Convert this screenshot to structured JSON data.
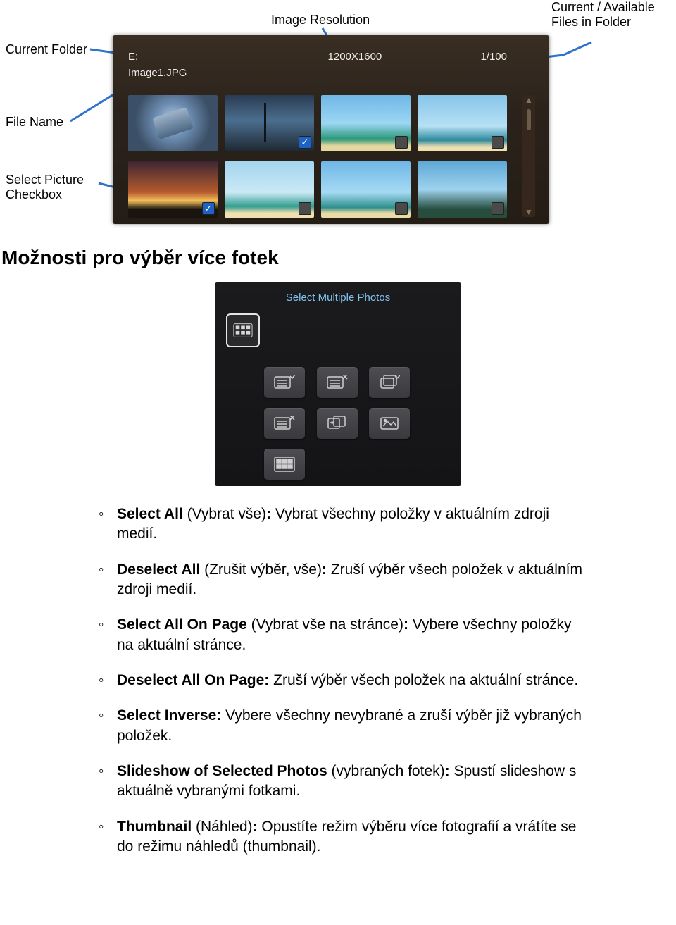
{
  "labels": {
    "current_folder": "Current Folder",
    "file_name": "File Name",
    "select_picture_checkbox": "Select Picture\nCheckbox",
    "image_resolution": "Image Resolution",
    "current_available_files": "Current / Available\nFiles in Folder"
  },
  "device": {
    "folder": "E:",
    "file": "Image1.JPG",
    "resolution": "1200X1600",
    "counter": "1/100"
  },
  "heading": "Možnosti pro výběr více fotek",
  "panel2": {
    "title": "Select Multiple Photos"
  },
  "items": [
    {
      "b": "Select All",
      "p1": " (Vybrat vše)",
      "c": ":",
      "r": " Vybrat všechny položky v aktuálním zdroji medií."
    },
    {
      "b": "Deselect All",
      "p1": " (Zrušit výběr, vše)",
      "c": ":",
      "r": " Zruší výběr všech položek v aktuálním zdroji medií."
    },
    {
      "b": "Select All On Page",
      "p1": " (Vybrat vše na stránce)",
      "c": ":",
      "r": " Vybere všechny položky na aktuální stránce."
    },
    {
      "b": "Deselect All On Page:",
      "p1": "",
      "c": "",
      "r": " Zruší výběr všech položek na aktuální stránce."
    },
    {
      "b": "Select Inverse:",
      "p1": "",
      "c": "",
      "r": " Vybere všechny nevybrané a zruší výběr již vybraných položek."
    },
    {
      "b": "Slideshow of Selected Photos",
      "p1": " (vybraných fotek)",
      "c": ":",
      "r": " Spustí slideshow s aktuálně vybranými fotkami."
    },
    {
      "b": "Thumbnail",
      "p1": " (Náhled)",
      "c": ":",
      "r": " Opustíte režim výběru více fotografií a vrátíte se do režimu náhledů (thumbnail)."
    }
  ]
}
